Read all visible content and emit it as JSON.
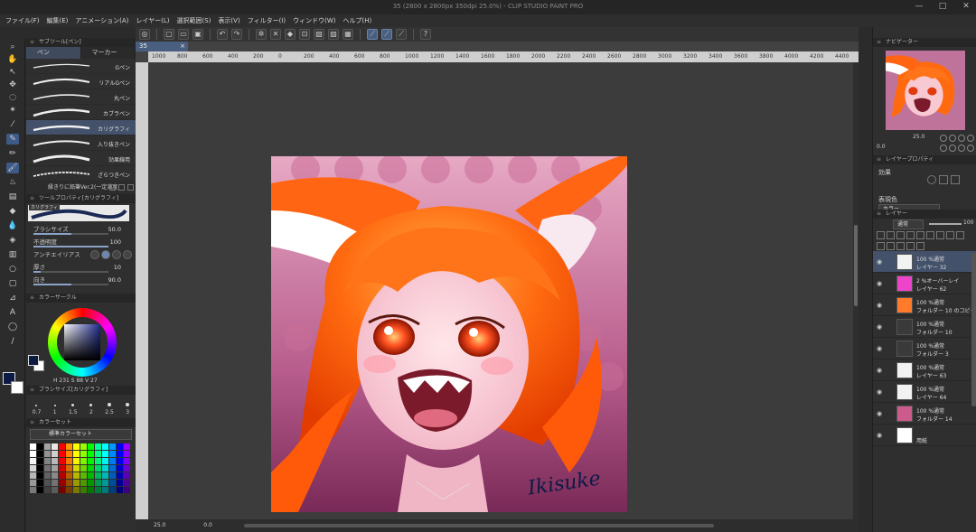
{
  "window": {
    "title": "35 (2800 x 2800px 350dpi 25.0%) - CLIP STUDIO PAINT PRO",
    "minimize": "—",
    "maximize": "□",
    "close": "✕"
  },
  "menu": [
    "ファイル(F)",
    "編集(E)",
    "アニメーション(A)",
    "レイヤー(L)",
    "選択範囲(S)",
    "表示(V)",
    "フィルター(I)",
    "ウィンドウ(W)",
    "ヘルプ(H)"
  ],
  "subtool": {
    "panel_title": "サブツール[ペン]",
    "tabs": [
      "ペン",
      "マーカー"
    ],
    "brushes": [
      "Gペン",
      "リアルGペン",
      "丸ペン",
      "カブラペン",
      "カリグラフィ",
      "入り抜きペン",
      "効果線用",
      "ざらつきペン"
    ],
    "selected_index": 4,
    "footer": "縁きりに鉛筆Ver.2(一定濃度)"
  },
  "tool_property": {
    "panel_title": "ツールプロパティ[カリグラフィ]",
    "preset_name": "カリグラフィ",
    "rows": [
      {
        "label": "ブラシサイズ",
        "value": "50.0",
        "fill": 0.5
      },
      {
        "label": "不透明度",
        "value": "100",
        "fill": 1.0
      },
      {
        "label": "アンチエイリアス",
        "value": ""
      },
      {
        "label": "厚さ",
        "value": "10",
        "fill": 0.1
      },
      {
        "label": "向き",
        "value": "90.0",
        "fill": 0.5
      }
    ]
  },
  "color_circle": {
    "panel_title": "カラーサークル",
    "readout": "H 231  S 88  V 27"
  },
  "brush_size": {
    "panel_title": "ブラシサイズ[カリグラフィ]",
    "sizes": [
      "0.7",
      "1",
      "1.5",
      "2",
      "2.5",
      "3"
    ]
  },
  "color_set": {
    "panel_title": "カラーセット",
    "select": "標準カラーセット"
  },
  "document": {
    "tab": "35",
    "tab_close": "×",
    "zoom": "25.0",
    "rotation": "0.0"
  },
  "ruler_ticks": [
    "1000",
    "800",
    "600",
    "400",
    "200",
    "0",
    "200",
    "400",
    "600",
    "800",
    "1000",
    "1200",
    "1400",
    "1600",
    "1800",
    "2000",
    "2200",
    "2400",
    "2600",
    "2800",
    "3000",
    "3200",
    "3400",
    "3600",
    "3800",
    "4000",
    "4200",
    "4400"
  ],
  "navigator": {
    "panel_title": "ナビゲーター",
    "zoom": "25.0",
    "rotation": "0.0"
  },
  "layer_property": {
    "panel_title": "レイヤープロパティ",
    "effect_label": "効果",
    "expression_label": "表現色",
    "expression_value": "カラー"
  },
  "layers_panel": {
    "panel_title": "レイヤー",
    "blend": "通常",
    "opacity": "100",
    "items": [
      {
        "mode": "100 %通常",
        "name": "レイヤー 32",
        "selected": true
      },
      {
        "mode": "2 %オーバーレイ",
        "name": "レイヤー 62",
        "selected": false
      },
      {
        "mode": "100 %通常",
        "name": "フォルダー 10 のコピー",
        "selected": false
      },
      {
        "mode": "100 %通常",
        "name": "フォルダー 10",
        "selected": false
      },
      {
        "mode": "100 %通常",
        "name": "フォルダー 3",
        "selected": false
      },
      {
        "mode": "100 %通常",
        "name": "レイヤー 63",
        "selected": false
      },
      {
        "mode": "100 %通常",
        "name": "レイヤー 64",
        "selected": false
      },
      {
        "mode": "100 %通常",
        "name": "フォルダー 14",
        "selected": false
      },
      {
        "mode": "",
        "name": "用紙",
        "selected": false
      }
    ]
  },
  "signature": "Ikisuke",
  "colors": {
    "accent": "#4a5f80",
    "main_color": "#0d1b44",
    "sub_color": "#ffffff"
  }
}
